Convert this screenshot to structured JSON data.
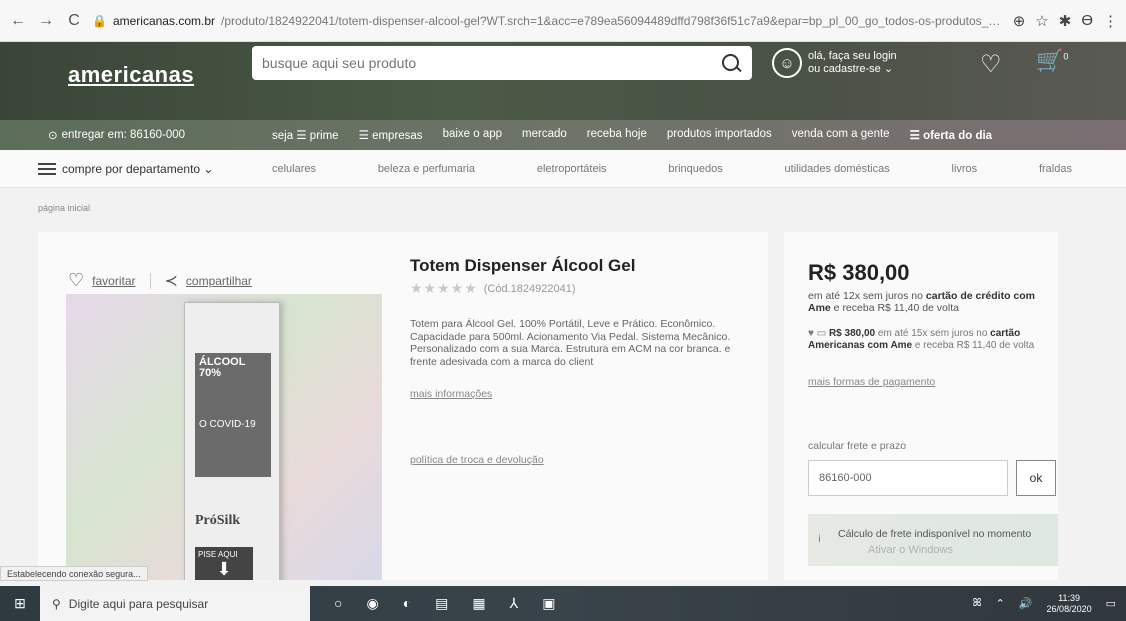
{
  "browser": {
    "back": "←",
    "forward": "→",
    "reload": "C",
    "host": "americanas.com.br",
    "path": "/produto/1824922041/totem-dispenser-alcool-gel?WT.srch=1&acc=e789ea56094489dffd798f36f51c7a9&epar=bp_pl_00_go_todos-os-produtos_ge...",
    "icons": [
      "⊕",
      "☆",
      "✱",
      "ϴ",
      "⋮"
    ]
  },
  "header": {
    "logo": "americanas",
    "search_placeholder": "busque aqui seu produto",
    "login_line1": "olá, faça seu login",
    "login_line2": "ou cadastre-se ⌄",
    "cart_count": "0"
  },
  "subnav": {
    "deliver": "entregar em: 86160-000",
    "links": [
      "seja ☰ prime",
      "☰ empresas",
      "baixe o app",
      "mercado",
      "receba hoje",
      "produtos importados",
      "venda com a gente",
      "☰ oferta do dia"
    ]
  },
  "departments": {
    "menu": "compre por departamento ⌄",
    "links": [
      "celulares",
      "beleza e perfumaria",
      "eletroportáteis",
      "brinquedos",
      "utilidades domésticas",
      "livros",
      "fraldas"
    ]
  },
  "breadcrumb": "página inicial",
  "product": {
    "favorite": "favoritar",
    "share": "compartilhar",
    "title": "Totem Dispenser Álcool Gel",
    "stars": "★★★★★",
    "code": "(Cód.1824922041)",
    "description": "Totem para Álcool Gel. 100% Portátil, Leve e Prático. Econômico. Capacidade para 500ml. Acionamento Via Pedal. Sistema Mecânico. Personalizado com a sua Marca. Estrutura em ACM na cor branca. e frente adesivada com a marca do client",
    "more_info": "mais informações",
    "policy": "política de troca e devolução",
    "image_text": {
      "alcool": "ÁLCOOL",
      "percent": "70%",
      "covid": "O COVID-19",
      "brand": "PróSilk",
      "press": "PISE AQUI"
    }
  },
  "pricing": {
    "price": "R$ 380,00",
    "installments_pre": "em até 12x sem juros no ",
    "installments_bold": "cartão de crédito com Ame",
    "installments_post": " e receba R$ 11,40 de volta",
    "ame_price": "R$ 380,00",
    "ame_text_1": " em até 15x sem juros no ",
    "ame_bold": "cartão Americanas com Ame",
    "ame_text_2": " e receba R$ 11,40 de volta",
    "more_payment": "mais formas de pagamento",
    "shipping_label": "calcular frete e prazo",
    "cep_value": "86160-000",
    "ok": "ok",
    "notice": "Cálculo de frete indisponível no momento"
  },
  "watermark": "Ativar o Windows",
  "status": "Estabelecendo conexão segura...",
  "taskbar": {
    "search": "Digite aqui para pesquisar",
    "time": "11:39",
    "date": "26/08/2020"
  }
}
